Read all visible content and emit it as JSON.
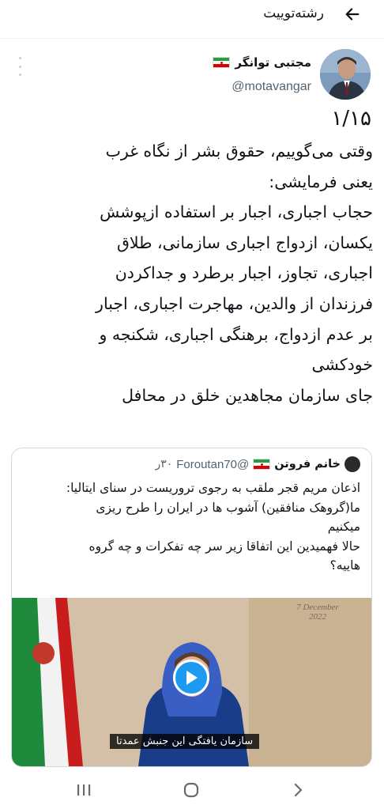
{
  "header": {
    "title": "رشته‌توییت",
    "back_icon": "arrow-left-icon"
  },
  "tweet": {
    "display_name": "مجتبی توانگر",
    "handle": "@motavangar",
    "count": "۱/۱۵",
    "text": "وقتی می‌گوییم، حقوق بشر از نگاه غرب\nیعنی فرمایشی:\nحجاب اجباری، اجبار بر استفاده ازپوشش\nیکسان، ازدواج اجباری سازمانی، طلاق\nاجباری، تجاوز، اجبار برطرد و جداکردن\nفرزندان از والدین، مهاجرت اجباری، اجبار\nبر عدم ازدواج، برهنگی اجباری، شکنجه و\nخودکشی\nجای سازمان مجاهدین خلق در محافل"
  },
  "quote": {
    "display_name": "خانم فروتن",
    "handle": "@Foroutan70",
    "time": "۳۰ر",
    "text": "اذعان مریم قجر ملقب به رجوی تروریست در سنای ایتالیا:\nما(گروهک منافقین) آشوب ها در ایران را طرح ریزی\nمیکنیم\nحالا فهمیدین این اتفاقا زیر سر چه تفکرات و چه گروه\nهاییه؟",
    "video_caption": "سازمان یافتگی این جنبش عمدتا",
    "video_date": "7 December\n2022"
  },
  "navbar": {
    "recents_icon": "recents-icon",
    "home_icon": "home-icon",
    "back_icon": "chevron-right-icon"
  },
  "colors": {
    "accent": "#1d9bf0",
    "muted": "#536471",
    "border": "#cfd9de"
  }
}
